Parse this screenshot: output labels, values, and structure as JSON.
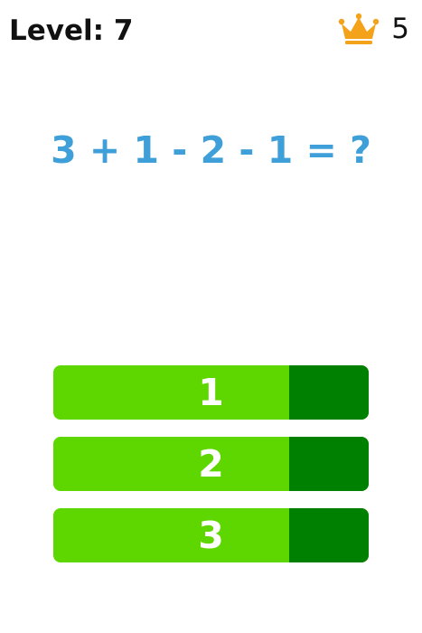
{
  "header": {
    "level_text": "Level: 7",
    "score": "5",
    "score_icon": "crown-icon"
  },
  "question": {
    "text": "3 + 1 - 2 - 1 = ?"
  },
  "answers": [
    {
      "label": "1"
    },
    {
      "label": "2"
    },
    {
      "label": "3"
    }
  ],
  "colors": {
    "question": "#3f9fd8",
    "button_light": "#5ed600",
    "button_dark": "#008000",
    "crown": "#f5a21b"
  }
}
